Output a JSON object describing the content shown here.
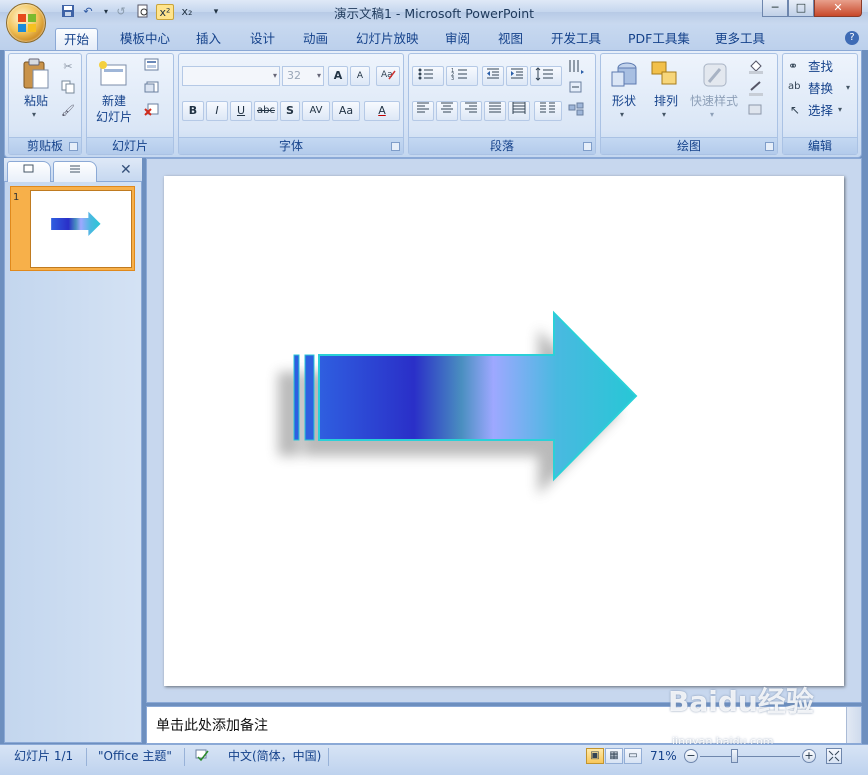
{
  "window": {
    "title": "演示文稿1 - Microsoft PowerPoint",
    "controls": {
      "minimize": "─",
      "maximize": "□",
      "close": "✕"
    }
  },
  "quick_access": {
    "save_icon": "save-icon",
    "undo_icon": "undo-icon",
    "redo_icon": "redo-icon",
    "print_preview_icon": "print-preview-icon",
    "superscript": "x²",
    "subscript": "x₂",
    "customize": "▾"
  },
  "tabs": [
    "开始",
    "模板中心",
    "插入",
    "设计",
    "动画",
    "幻灯片放映",
    "审阅",
    "视图",
    "开发工具",
    "PDF工具集",
    "更多工具"
  ],
  "ribbon": {
    "clipboard": {
      "label": "剪贴板",
      "paste": "粘贴"
    },
    "slides": {
      "label": "幻灯片",
      "new_slide_line1": "新建",
      "new_slide_line2": "幻灯片"
    },
    "font": {
      "label": "字体",
      "font_name": "",
      "font_size": "32",
      "buttons": [
        "B",
        "I",
        "U",
        "abc",
        "S",
        "AV",
        "Aa",
        "A"
      ],
      "grow": "A",
      "shrink": "A"
    },
    "paragraph": {
      "label": "段落"
    },
    "drawing": {
      "label": "绘图",
      "shapes": "形状",
      "arrange": "排列",
      "quick_styles": "快速样式"
    },
    "editing": {
      "label": "编辑",
      "find": "查找",
      "replace": "替换",
      "select": "选择"
    }
  },
  "slides_panel": {
    "slide_number": "1",
    "close": "✕"
  },
  "notes": {
    "placeholder": "单击此处添加备注"
  },
  "watermark": {
    "main": "Baidu经验",
    "sub": "jingyan.baidu.com"
  },
  "status": {
    "slide": "幻灯片 1/1",
    "theme": "\"Office 主题\"",
    "language": "中文(简体，中国)",
    "zoom": "71%"
  },
  "colors": {
    "ribbon_accent": "#15428b",
    "arrow_gradient": [
      "#2f5fe0",
      "#2a2fc8",
      "#4a8fc0",
      "#9ea8ff",
      "#49b9e0",
      "#27c7d6"
    ]
  }
}
